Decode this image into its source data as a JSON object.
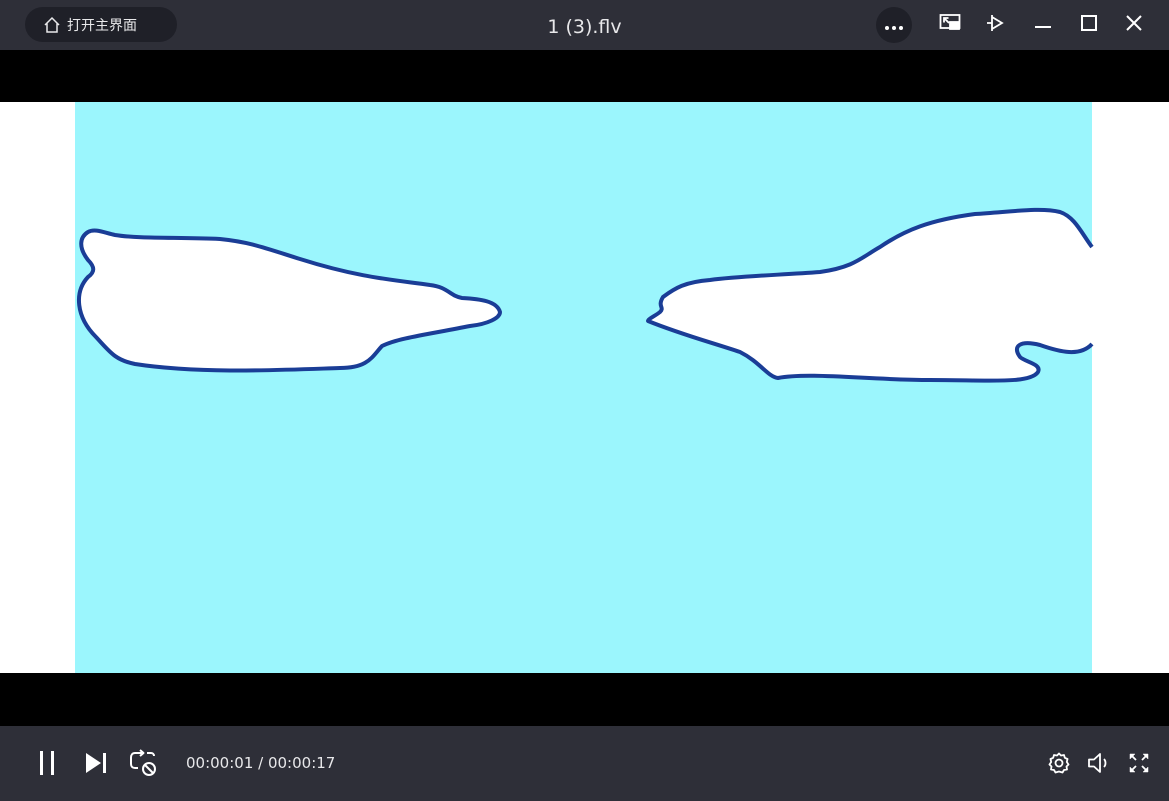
{
  "titlebar": {
    "home_label": "打开主界面",
    "title": "1 (3).flv"
  },
  "icons": {
    "home": "home-icon",
    "more": "more-icon",
    "mini_mode": "mini-mode-icon",
    "pin": "pin-icon",
    "minimize": "minimize-icon",
    "maximize": "maximize-icon",
    "close": "close-icon",
    "pause": "pause-icon",
    "next": "next-icon",
    "loop": "loop-off-icon",
    "settings": "gear-icon",
    "volume": "volume-icon",
    "fullscreen": "fullscreen-icon"
  },
  "playback": {
    "current_time": "00:00:01",
    "separator": " / ",
    "duration": "00:00:17"
  },
  "colors": {
    "bar_bg": "#2e2f38",
    "pill_bg": "#1f2028",
    "sky": "#9bf6fd",
    "cloud_outline": "#1a3d96"
  }
}
